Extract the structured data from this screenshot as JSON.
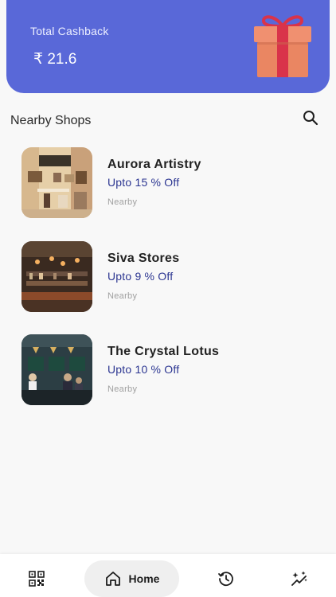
{
  "cashback": {
    "title": "Total Cashback",
    "amount": "₹ 21.6"
  },
  "nearby": {
    "title": "Nearby Shops",
    "search_icon": "search-icon"
  },
  "shops": [
    {
      "name": "Aurora Artistry",
      "offer": "Upto 15 % Off",
      "distance": "Nearby"
    },
    {
      "name": "Siva Stores",
      "offer": "Upto 9 % Off",
      "distance": "Nearby"
    },
    {
      "name": "The Crystal Lotus",
      "offer": "Upto 10 % Off",
      "distance": "Nearby"
    }
  ],
  "nav": {
    "items": [
      {
        "icon": "qr-code-icon"
      },
      {
        "icon": "home-icon",
        "label": "Home",
        "active": true
      },
      {
        "icon": "history-icon"
      },
      {
        "icon": "sparkle-chart-icon"
      }
    ]
  },
  "colors": {
    "card": "#5968d8",
    "offer_text": "#2b3591",
    "gift_box": "#ea8662",
    "gift_ribbon": "#d9334a"
  }
}
